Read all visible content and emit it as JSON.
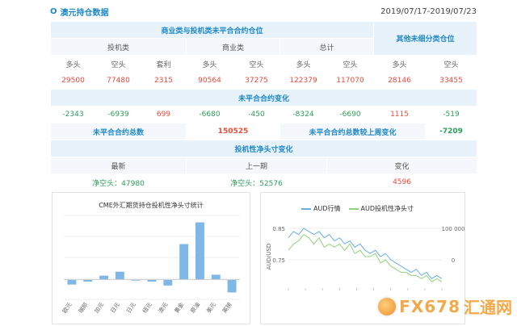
{
  "header": {
    "marker": "O",
    "title": "澳元持仓数据",
    "date_range": "2019/07/17-2019/07/23"
  },
  "table": {
    "section1_title": "商业类与投机类未平合合约仓位",
    "other_title": "其他未细分类仓位",
    "groups": [
      "投机类",
      "商业类",
      "总计"
    ],
    "col_labels": [
      "多头",
      "空头",
      "套利",
      "多头",
      "空头",
      "多头",
      "空头",
      "多头",
      "空头"
    ],
    "row1": [
      "29500",
      "77480",
      "2315",
      "90564",
      "37275",
      "122379",
      "117070",
      "28146",
      "33455"
    ],
    "section2_title": "未平合合约变化",
    "row2": [
      "-2343",
      "-6939",
      "699",
      "-6680",
      "-450",
      "-8324",
      "-6690",
      "1115",
      "-519"
    ],
    "open_total_label": "未平合合约总数",
    "open_total_value": "150525",
    "weekly_change_label": "未平合合约总数较上周变化",
    "weekly_change_value": "-7209",
    "section3_title": "投机性净头寸变化",
    "net_labels": [
      "最新",
      "上一期",
      "变化"
    ],
    "net_values": [
      "净空头：47980",
      "净空头：52576",
      "4596"
    ]
  },
  "chart_data": [
    {
      "type": "bar",
      "title": "CME外汇期货持仓投机性净头寸统计",
      "categories": [
        "欧元",
        "瑞郎",
        "加元",
        "日元",
        "日元",
        "纽元",
        "澳元",
        "黄金",
        "原油",
        "美元",
        "英镑"
      ],
      "values": [
        -0.5,
        -0.2,
        0.4,
        0.8,
        -0.1,
        -0.2,
        -0.6,
        3.6,
        5.8,
        0.5,
        -1.3
      ],
      "ylim": [
        -2.0,
        6.5
      ],
      "grid": true,
      "color": "#7fb8e6"
    },
    {
      "type": "line",
      "legend": [
        "AUD行情",
        "AUD投机性净头寸"
      ],
      "legend_position": "top",
      "ylabel_left": "AUD/USD",
      "y_left_ticks": [
        "0.85",
        "0.75"
      ],
      "y_right_ticks": [
        "100 000",
        "0"
      ],
      "series": [
        {
          "name": "AUD行情",
          "color": "#6aaee0",
          "values": [
            0.82,
            0.84,
            0.83,
            0.85,
            0.84,
            0.83,
            0.84,
            0.82,
            0.83,
            0.81,
            0.82,
            0.8,
            0.81,
            0.79,
            0.8,
            0.78,
            0.77,
            0.78,
            0.76,
            0.77,
            0.75,
            0.74,
            0.73,
            0.72,
            0.71,
            0.72,
            0.7,
            0.71,
            0.69,
            0.7,
            0.69
          ]
        },
        {
          "name": "AUD投机性净头寸",
          "color": "#8fd47a",
          "values": [
            0.78,
            0.8,
            0.81,
            0.83,
            0.82,
            0.8,
            0.82,
            0.79,
            0.8,
            0.79,
            0.8,
            0.78,
            0.8,
            0.77,
            0.78,
            0.76,
            0.76,
            0.77,
            0.74,
            0.75,
            0.73,
            0.72,
            0.71,
            0.71,
            0.7,
            0.7,
            0.69,
            0.7,
            0.68,
            0.69,
            0.68
          ]
        }
      ]
    }
  ],
  "watermark": {
    "text": "FX678",
    "text2": "汇通网"
  }
}
